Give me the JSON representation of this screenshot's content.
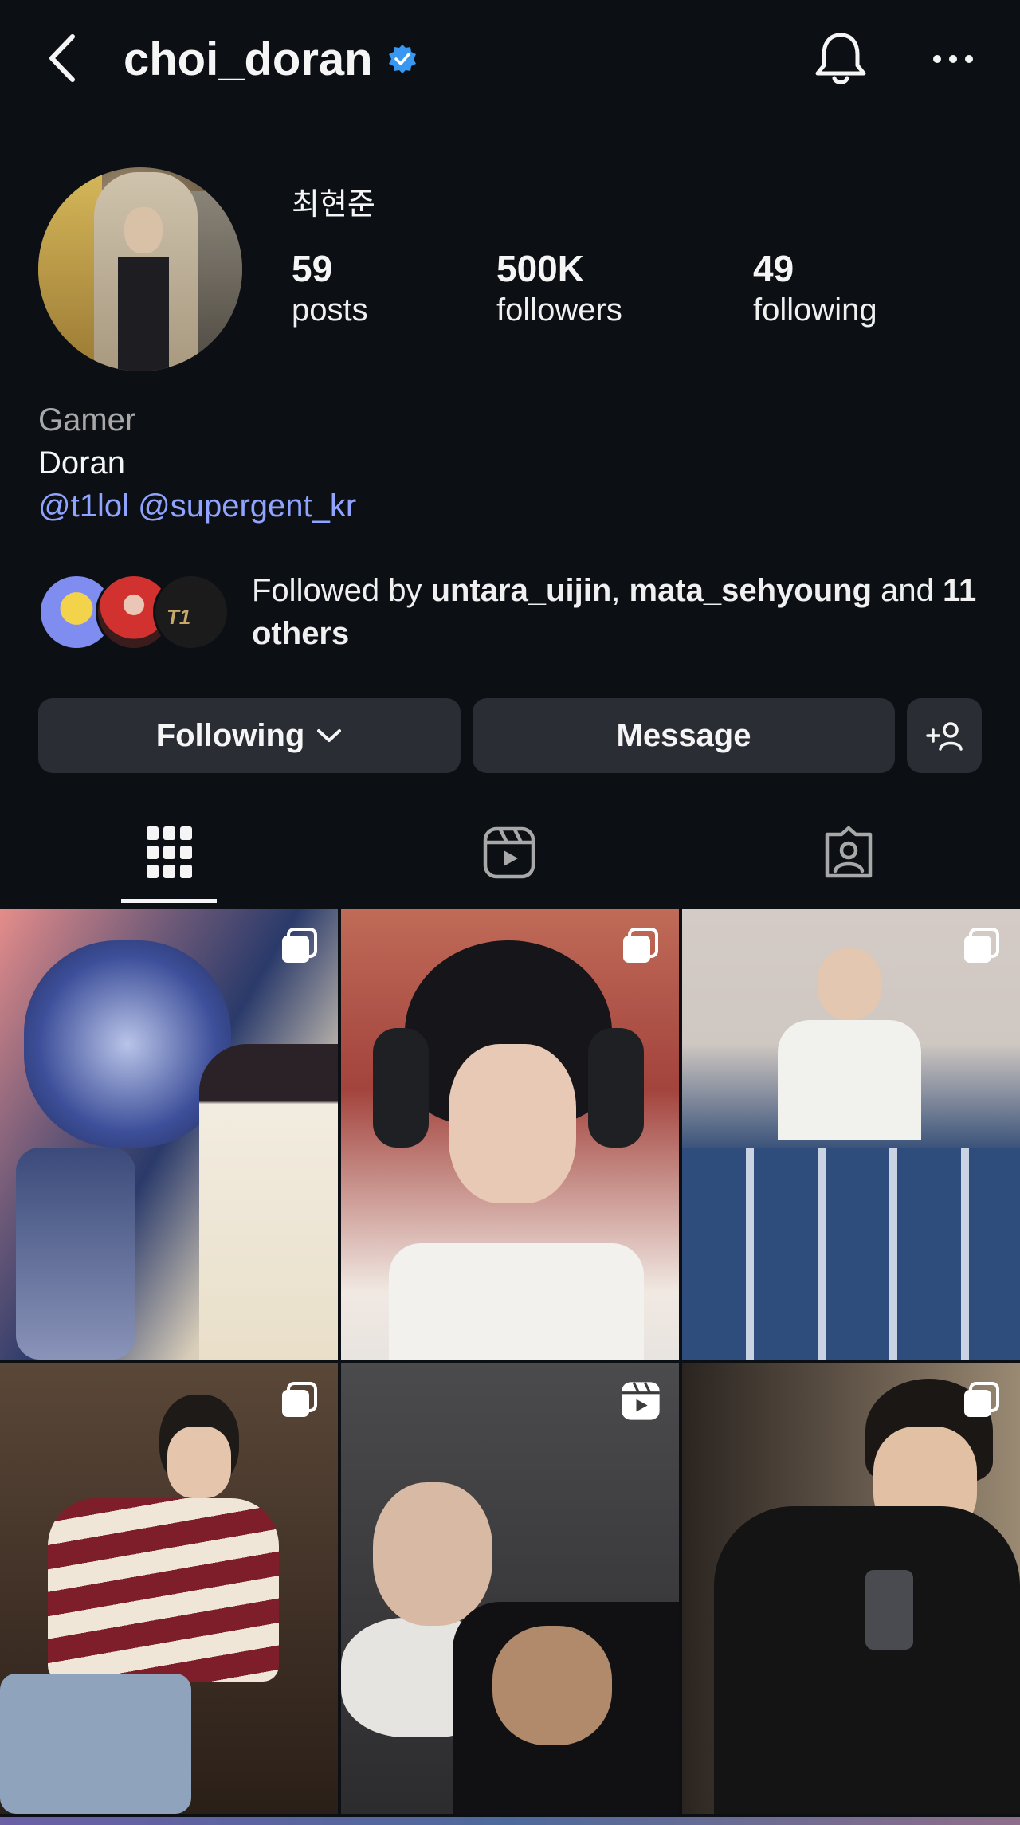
{
  "header": {
    "username": "choi_doran"
  },
  "profile": {
    "real_name": "최현준",
    "stats": [
      {
        "count": "59",
        "label": "posts"
      },
      {
        "count": "500K",
        "label": "followers"
      },
      {
        "count": "49",
        "label": "following"
      }
    ],
    "bio": {
      "category": "Gamer",
      "name": "Doran",
      "tags": "@t1lol @supergent_kr"
    },
    "followed_by": {
      "prefix": "Followed by ",
      "user1": "untara_uijin",
      "sep": ", ",
      "user2": "mata_sehyoung",
      "and": " and ",
      "others": "11 others"
    }
  },
  "actions": {
    "following_label": "Following",
    "message_label": "Message"
  },
  "colors": {
    "background": "#0c1014",
    "button": "#2a2e34",
    "link": "#8fa3ff",
    "verified": "#3897f0"
  },
  "icons": {
    "header": [
      "back-arrow-icon",
      "verified-badge-icon",
      "bell-icon",
      "more-icon"
    ],
    "tabs": [
      "grid-icon",
      "reels-icon",
      "tagged-icon"
    ]
  },
  "tabs_active": "grid-icon"
}
